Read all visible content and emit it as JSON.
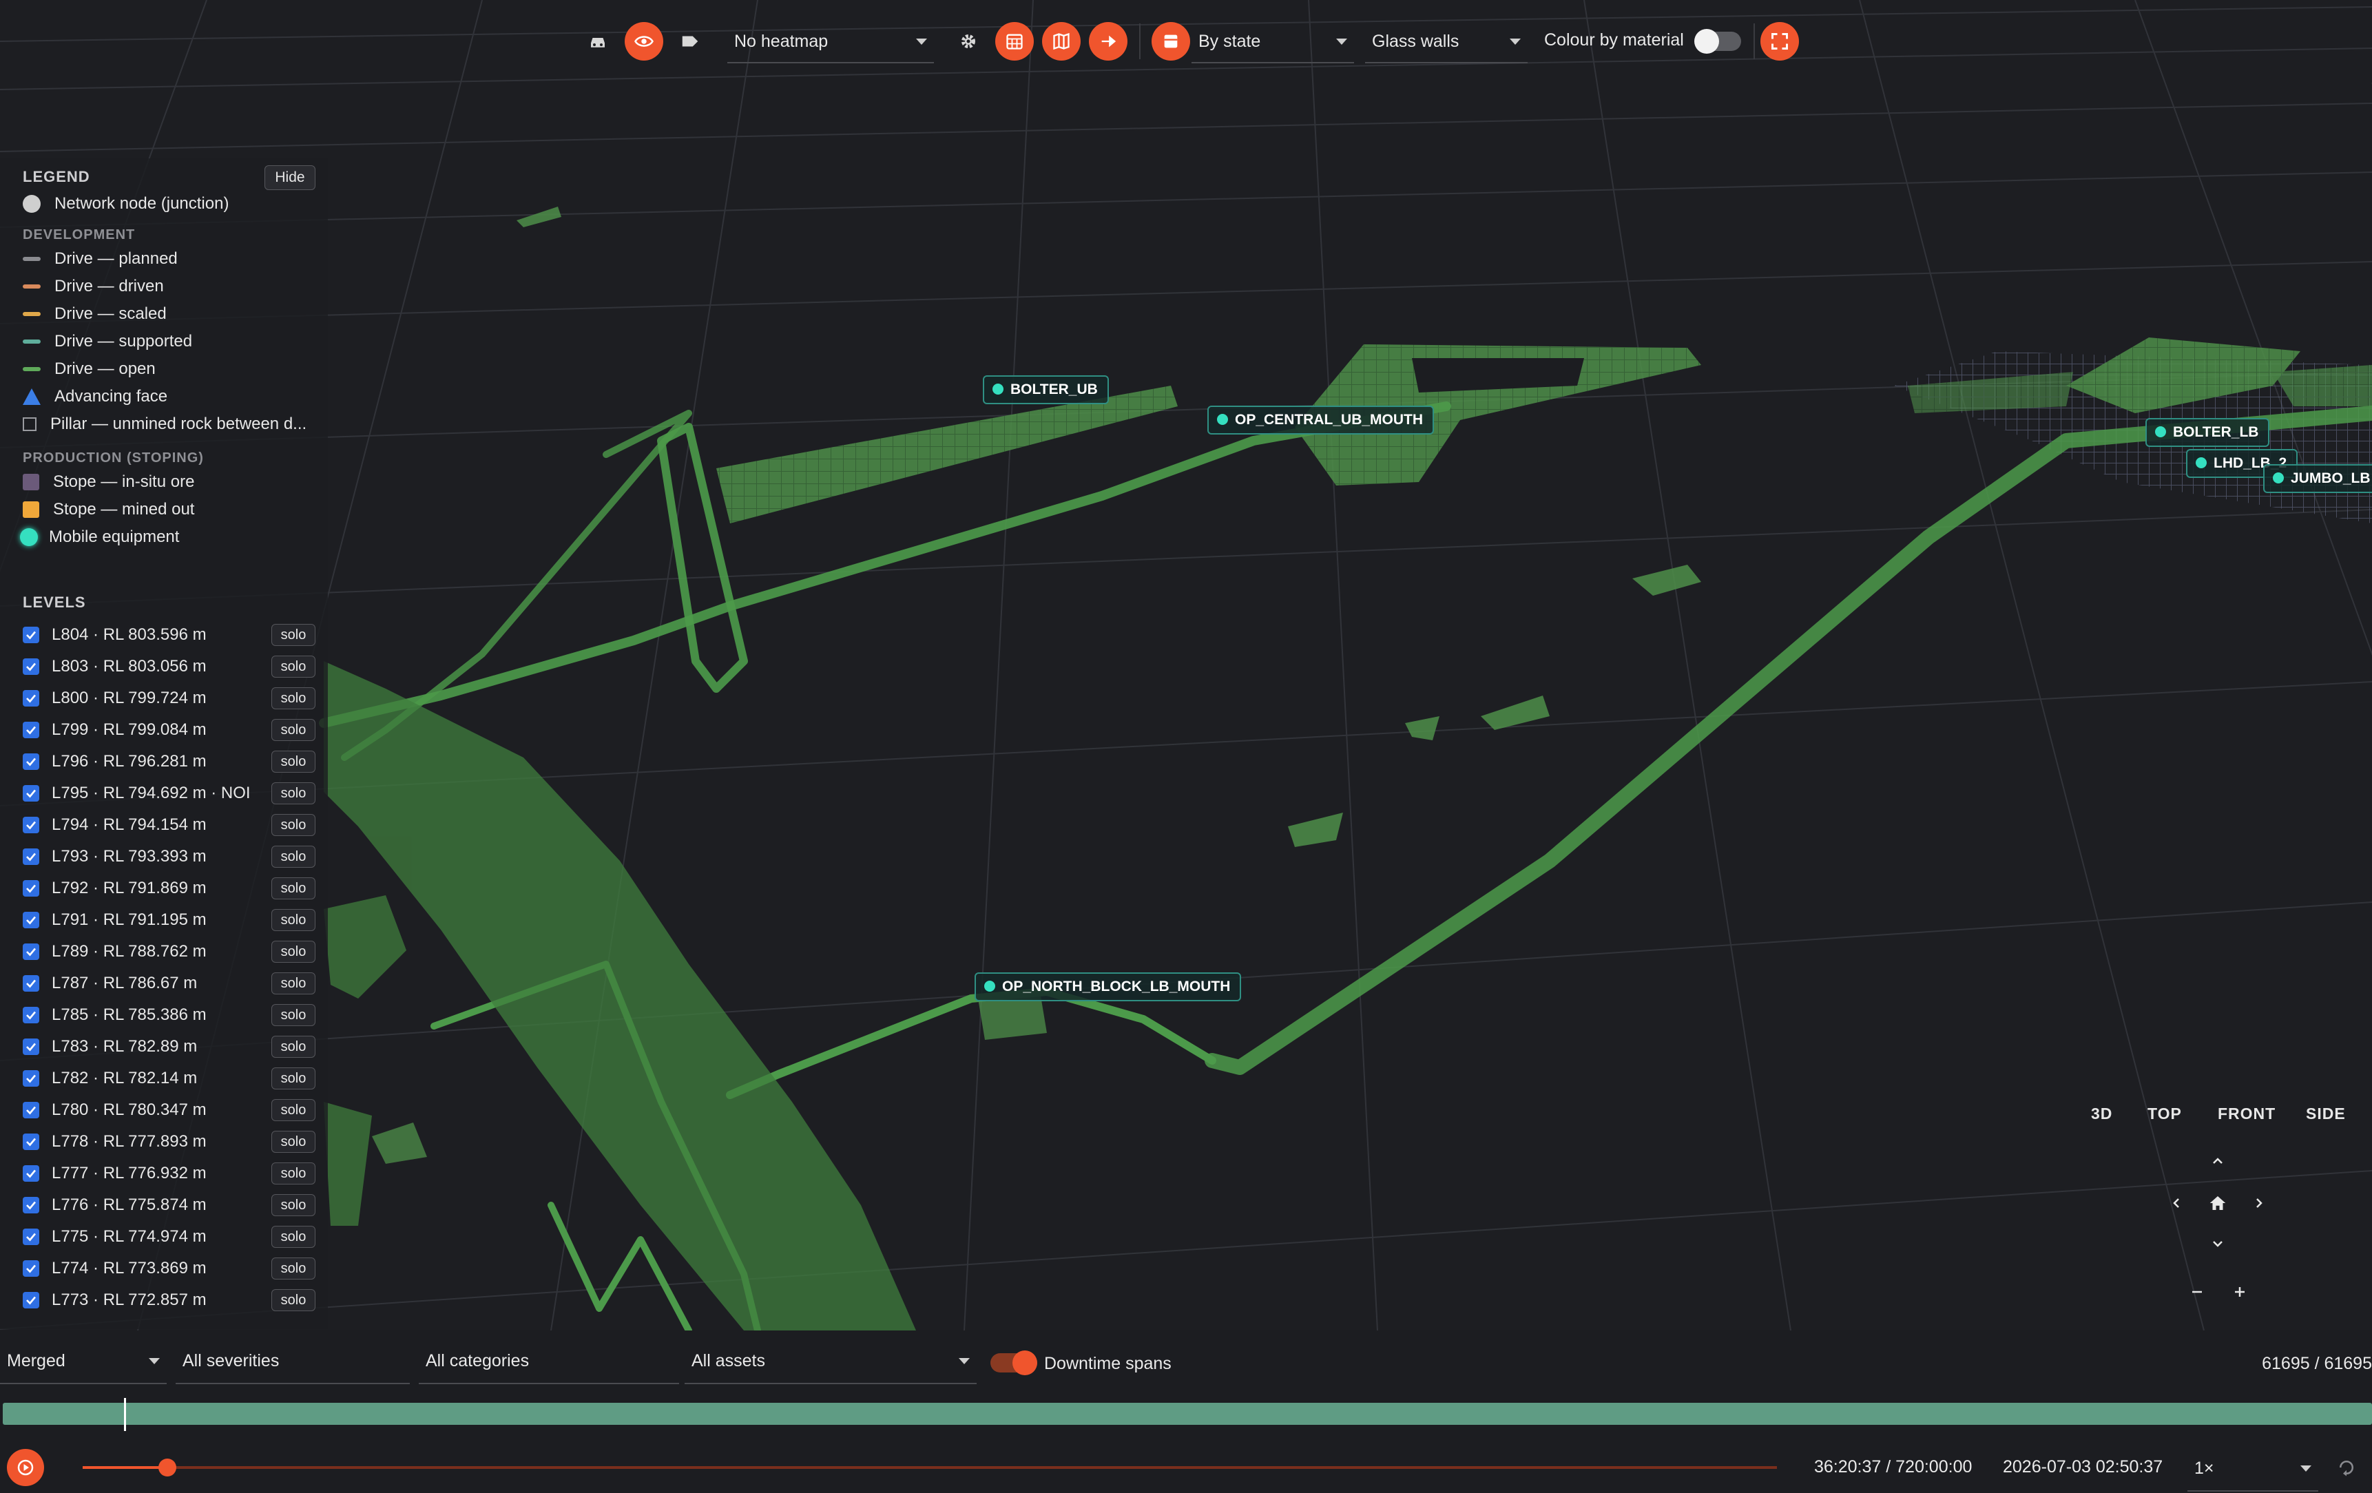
{
  "toolbar": {
    "heatmap": "No heatmap",
    "state_mode": "By state",
    "walls_mode": "Glass walls",
    "colour_by_material_label": "Colour by material",
    "colour_by_material_on": false
  },
  "legend": {
    "title": "LEGEND",
    "hide_label": "Hide",
    "network_node": "Network node (junction)",
    "development_heading": "DEVELOPMENT",
    "development_items": [
      {
        "label": "Drive — planned",
        "color": "#8a8b90"
      },
      {
        "label": "Drive — driven",
        "color": "#d98a5c"
      },
      {
        "label": "Drive — scaled",
        "color": "#e0a84a"
      },
      {
        "label": "Drive — supported",
        "color": "#5fae9c"
      },
      {
        "label": "Drive — open",
        "color": "#5faa5a"
      }
    ],
    "advancing_face": "Advancing face",
    "pillar": "Pillar — unmined rock between d...",
    "production_heading": "PRODUCTION (STOPING)",
    "stope_insitu": "Stope — in-situ ore",
    "stope_mined": "Stope — mined out",
    "mobile_equipment": "Mobile equipment",
    "colors": {
      "node": "#cfcfcf",
      "face": "#3b7ee6",
      "stope_insitu": "#6b5a7a",
      "stope_mined": "#f0a83a",
      "equipment": "#35e0c0"
    }
  },
  "levels": {
    "heading": "LEVELS",
    "solo_label": "solo",
    "items": [
      "L804 · RL 803.596 m",
      "L803 · RL 803.056 m",
      "L800 · RL 799.724 m",
      "L799 · RL 799.084 m",
      "L796 · RL 796.281 m",
      "L795 · RL 794.692 m · NOI",
      "L794 · RL 794.154 m",
      "L793 · RL 793.393 m",
      "L792 · RL 791.869 m",
      "L791 · RL 791.195 m",
      "L789 · RL 788.762 m",
      "L787 · RL 786.67 m",
      "L785 · RL 785.386 m",
      "L783 · RL 782.89 m",
      "L782 · RL 782.14 m",
      "L780 · RL 780.347 m",
      "L778 · RL 777.893 m",
      "L777 · RL 776.932 m",
      "L776 · RL 775.874 m",
      "L775 · RL 774.974 m",
      "L774 · RL 773.869 m",
      "L773 · RL 772.857 m"
    ]
  },
  "equipment_tags": {
    "bolter_ub": "BOLTER_UB",
    "op_central": "OP_CENTRAL_UB_MOUTH",
    "bolter_lb": "BOLTER_LB",
    "lhd_lb_2": "LHD_LB_2",
    "jumbo_lb": "JUMBO_LB",
    "op_north": "OP_NORTH_BLOCK_LB_MOUTH"
  },
  "view_controls": {
    "v3d": "3D",
    "top": "TOP",
    "front": "FRONT",
    "side": "SIDE"
  },
  "filters": {
    "merge_mode": "Merged",
    "severity": "All severities",
    "category": "All categories",
    "assets": "All assets",
    "downtime_label": "Downtime spans",
    "downtime_on": true,
    "event_count": "61695 / 61695"
  },
  "playback": {
    "progress": 0.05,
    "time_readout": "36:20:37 / 720:00:00",
    "datetime": "2026-07-03 02:50:37",
    "speed": "1×"
  }
}
